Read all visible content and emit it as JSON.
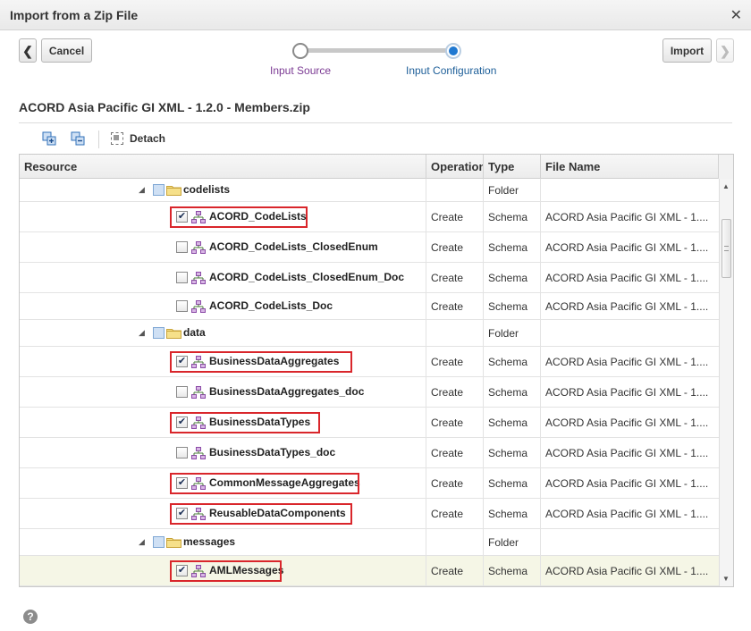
{
  "dialog": {
    "title": "Import from a Zip File",
    "close_glyph": "✕"
  },
  "nav": {
    "back_glyph": "❮",
    "cancel_label": "Cancel",
    "import_label": "Import",
    "next_glyph": "❯"
  },
  "train": {
    "steps": [
      {
        "label": "Input Source",
        "state": "visited"
      },
      {
        "label": "Input Configuration",
        "state": "current"
      }
    ],
    "current_step_color": "#1f78d1"
  },
  "zip_name": "ACORD Asia Pacific GI XML - 1.2.0 - Members.zip",
  "toolbar": {
    "expand_icon": "expand-all-icon",
    "collapse_icon": "collapse-all-icon",
    "detach_label": "Detach"
  },
  "table": {
    "columns": [
      "Resource",
      "Operation",
      "Type",
      "File Name"
    ],
    "rows": [
      {
        "kind": "folder",
        "name": "codelists",
        "operation": "",
        "type": "Folder",
        "file": ""
      },
      {
        "kind": "schema",
        "name": "ACORD_CodeLists",
        "checked": true,
        "highlighted": true,
        "operation": "Create",
        "type": "Schema",
        "file": "ACORD Asia Pacific GI XML - 1...."
      },
      {
        "kind": "schema",
        "name": "ACORD_CodeLists_ClosedEnum",
        "checked": false,
        "highlighted": false,
        "operation": "Create",
        "type": "Schema",
        "file": "ACORD Asia Pacific GI XML - 1...."
      },
      {
        "kind": "schema",
        "name": "ACORD_CodeLists_ClosedEnum_Doc",
        "checked": false,
        "highlighted": false,
        "operation": "Create",
        "type": "Schema",
        "file": "ACORD Asia Pacific GI XML - 1...."
      },
      {
        "kind": "schema",
        "name": "ACORD_CodeLists_Doc",
        "checked": false,
        "highlighted": false,
        "operation": "Create",
        "type": "Schema",
        "file": "ACORD Asia Pacific GI XML - 1...."
      },
      {
        "kind": "folder",
        "name": "data",
        "operation": "",
        "type": "Folder",
        "file": ""
      },
      {
        "kind": "schema",
        "name": "BusinessDataAggregates",
        "checked": true,
        "highlighted": true,
        "operation": "Create",
        "type": "Schema",
        "file": "ACORD Asia Pacific GI XML - 1...."
      },
      {
        "kind": "schema",
        "name": "BusinessDataAggregates_doc",
        "checked": false,
        "highlighted": false,
        "operation": "Create",
        "type": "Schema",
        "file": "ACORD Asia Pacific GI XML - 1...."
      },
      {
        "kind": "schema",
        "name": "BusinessDataTypes",
        "checked": true,
        "highlighted": true,
        "operation": "Create",
        "type": "Schema",
        "file": "ACORD Asia Pacific GI XML - 1...."
      },
      {
        "kind": "schema",
        "name": "BusinessDataTypes_doc",
        "checked": false,
        "highlighted": false,
        "operation": "Create",
        "type": "Schema",
        "file": "ACORD Asia Pacific GI XML - 1...."
      },
      {
        "kind": "schema",
        "name": "CommonMessageAggregates",
        "checked": true,
        "highlighted": true,
        "operation": "Create",
        "type": "Schema",
        "file": "ACORD Asia Pacific GI XML - 1...."
      },
      {
        "kind": "schema",
        "name": "ReusableDataComponents",
        "checked": true,
        "highlighted": true,
        "operation": "Create",
        "type": "Schema",
        "file": "ACORD Asia Pacific GI XML - 1...."
      },
      {
        "kind": "folder",
        "name": "messages",
        "operation": "",
        "type": "Folder",
        "file": ""
      },
      {
        "kind": "schema",
        "name": "AMLMessages",
        "checked": true,
        "highlighted": true,
        "selected": true,
        "operation": "Create",
        "type": "Schema",
        "file": "ACORD Asia Pacific GI XML - 1...."
      }
    ]
  },
  "colors": {
    "highlight_border": "#d9262b",
    "selected_row": "#f5f6e6",
    "step_visited_text": "#7b3a93",
    "step_current_text": "#1e5f99"
  },
  "help_glyph": "?"
}
